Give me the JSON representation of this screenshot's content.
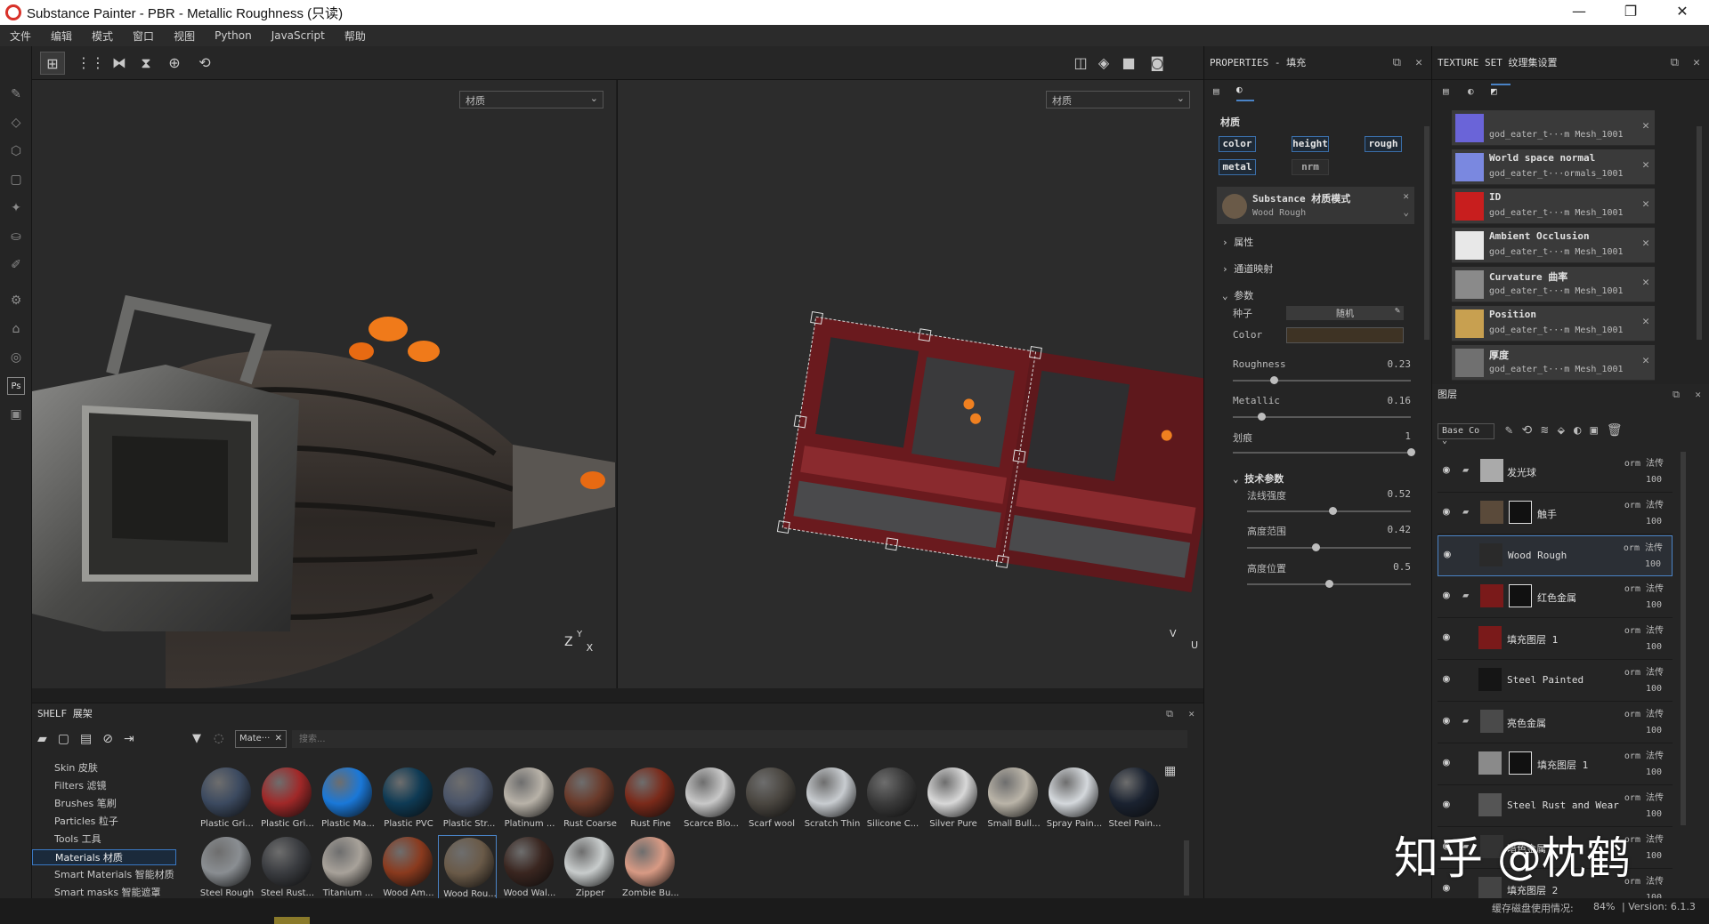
{
  "window": {
    "title": "Substance Painter - PBR - Metallic Roughness (只读)",
    "min": "—",
    "restore": "❐",
    "close": "✕"
  },
  "menu": [
    "文件",
    "编辑",
    "模式",
    "窗口",
    "视图",
    "Python",
    "JavaScript",
    "帮助"
  ],
  "viewport": {
    "left_select": "材质",
    "right_select": "材质",
    "axis_left": [
      "Z",
      "Y",
      "X"
    ],
    "axis_right": [
      "V",
      "U"
    ]
  },
  "properties": {
    "title": "PROPERTIES - 填充",
    "section_material": "材质",
    "chips": [
      "color",
      "height",
      "rough",
      "metal",
      "nrm"
    ],
    "substance_title": "Substance 材质模式",
    "substance_sub": "Wood Rough",
    "group_attrs": "属性",
    "group_channel_map": "通道映射",
    "group_params": "参数",
    "seed_label": "种子",
    "seed_value": "随机",
    "color_label": "Color",
    "roughness_label": "Roughness",
    "roughness_value": "0.23",
    "metallic_label": "Metallic",
    "metallic_value": "0.16",
    "scratches_label": "划痕",
    "scratches_value": "1",
    "tech_group": "技术参数",
    "normal_label": "法线强度",
    "normal_value": "0.52",
    "height_range_label": "高度范围",
    "height_range_value": "0.42",
    "height_pos_label": "高度位置",
    "height_pos_value": "0.5"
  },
  "texture_set": {
    "title": "TEXTURE SET 纹理集设置",
    "items": [
      {
        "title": "",
        "sub": "god_eater_t···m Mesh_1001",
        "color": "#6a64d8"
      },
      {
        "title": "World space normal",
        "sub": "god_eater_t···ormals_1001",
        "color": "#7a88e0"
      },
      {
        "title": "ID",
        "sub": "god_eater_t···m Mesh_1001",
        "color": "#c81e1e"
      },
      {
        "title": "Ambient Occlusion",
        "sub": "god_eater_t···m Mesh_1001",
        "color": "#e8e8e8"
      },
      {
        "title": "Curvature 曲率",
        "sub": "god_eater_t···m Mesh_1001",
        "color": "#8a8a8a"
      },
      {
        "title": "Position",
        "sub": "god_eater_t···m Mesh_1001",
        "color": "#c8a050"
      },
      {
        "title": "厚度",
        "sub": "god_eater_t···m Mesh_1001",
        "color": "#707070"
      }
    ]
  },
  "layers": {
    "title": "图层",
    "channel_select": "Base Co",
    "items": [
      {
        "name": "发光球",
        "blend": "orm 法传",
        "opacity": "100",
        "folder": true,
        "thumb": "#aaaaaa",
        "mask": ""
      },
      {
        "name": "触手",
        "blend": "orm 法传",
        "opacity": "100",
        "folder": true,
        "thumb": "#5a4a3a",
        "mask": "#111111"
      },
      {
        "name": "Wood Rough",
        "blend": "orm 法传",
        "opacity": "100",
        "folder": false,
        "thumb": "#2a2a2a",
        "mask": ""
      },
      {
        "name": "红色金属",
        "blend": "orm 法传",
        "opacity": "100",
        "folder": true,
        "thumb": "#7a1a1a",
        "mask": "#111111"
      },
      {
        "name": "填充图层 1",
        "blend": "orm 法传",
        "opacity": "100",
        "folder": false,
        "thumb": "#7a1a1a",
        "mask": ""
      },
      {
        "name": "Steel Painted",
        "blend": "orm 法传",
        "opacity": "100",
        "folder": false,
        "thumb": "#151515",
        "mask": ""
      },
      {
        "name": "亮色金属",
        "blend": "orm 法传",
        "opacity": "100",
        "folder": true,
        "thumb": "#4a4a4a",
        "mask": ""
      },
      {
        "name": "填充图层 1",
        "blend": "orm 法传",
        "opacity": "100",
        "folder": false,
        "thumb": "#8a8a8a",
        "mask": "#111111"
      },
      {
        "name": "Steel Rust and Wear",
        "blend": "orm 法传",
        "opacity": "100",
        "folder": false,
        "thumb": "#555555",
        "mask": ""
      },
      {
        "name": "暗色金属",
        "blend": "orm 法传",
        "opacity": "100",
        "folder": true,
        "thumb": "#333333",
        "mask": ""
      },
      {
        "name": "填充图层 2",
        "blend": "orm 法传",
        "opacity": "100",
        "folder": false,
        "thumb": "#444444",
        "mask": ""
      }
    ]
  },
  "shelf": {
    "title": "SHELF 展架",
    "filter_tag": "Mate···",
    "search_placeholder": "搜索...",
    "categories": [
      "Skin 皮肤",
      "Filters 滤镜",
      "Brushes 笔刷",
      "Particles 粒子",
      "Tools 工具",
      "Materials 材质",
      "Smart Materials 智能材质",
      "Smart masks 智能遮罩"
    ],
    "active_category": "Materials 材质",
    "materials": [
      {
        "label": "Plastic Gri...",
        "color": "#3c4a60"
      },
      {
        "label": "Plastic Gri...",
        "color": "#a02828"
      },
      {
        "label": "Plastic Ma...",
        "color": "#1a78d8"
      },
      {
        "label": "Plastic PVC",
        "color": "#0e3a54"
      },
      {
        "label": "Plastic Str...",
        "color": "#4a5468"
      },
      {
        "label": "Platinum ...",
        "color": "#b8b2a8"
      },
      {
        "label": "Rust Coarse",
        "color": "#6a3a2a"
      },
      {
        "label": "Rust Fine",
        "color": "#7a2a1a"
      },
      {
        "label": "Scarce Blo...",
        "color": "#c8c8c8"
      },
      {
        "label": "Scarf wool",
        "color": "#4a4640"
      },
      {
        "label": "Scratch Thin",
        "color": "#c8ccd0"
      },
      {
        "label": "Silicone C...",
        "color": "#3a3a3a"
      },
      {
        "label": "Silver Pure",
        "color": "#d8d8d8"
      },
      {
        "label": "Small Bull...",
        "color": "#bab4a8"
      },
      {
        "label": "Spray Pain...",
        "color": "#d4d8dc"
      },
      {
        "label": "Steel Pain...",
        "color": "#1a2230"
      },
      {
        "label": "Steel Rough",
        "color": "#8a8e92"
      },
      {
        "label": "Steel Rust...",
        "color": "#3a3c40"
      },
      {
        "label": "Titanium ...",
        "color": "#a8a29a"
      },
      {
        "label": "Wood Am...",
        "color": "#8a3a1e"
      },
      {
        "label": "Wood Rou...",
        "color": "#6a5a48"
      },
      {
        "label": "Wood Wal...",
        "color": "#3a2620"
      },
      {
        "label": "Zipper",
        "color": "#c8cccc"
      },
      {
        "label": "Zombie Bu...",
        "color": "#d89a84"
      }
    ]
  },
  "status": {
    "text": "缓存磁盘使用情况:",
    "percent": "84%",
    "version": "| Version: 6.1.3"
  },
  "watermark": "知乎 @枕鹤"
}
